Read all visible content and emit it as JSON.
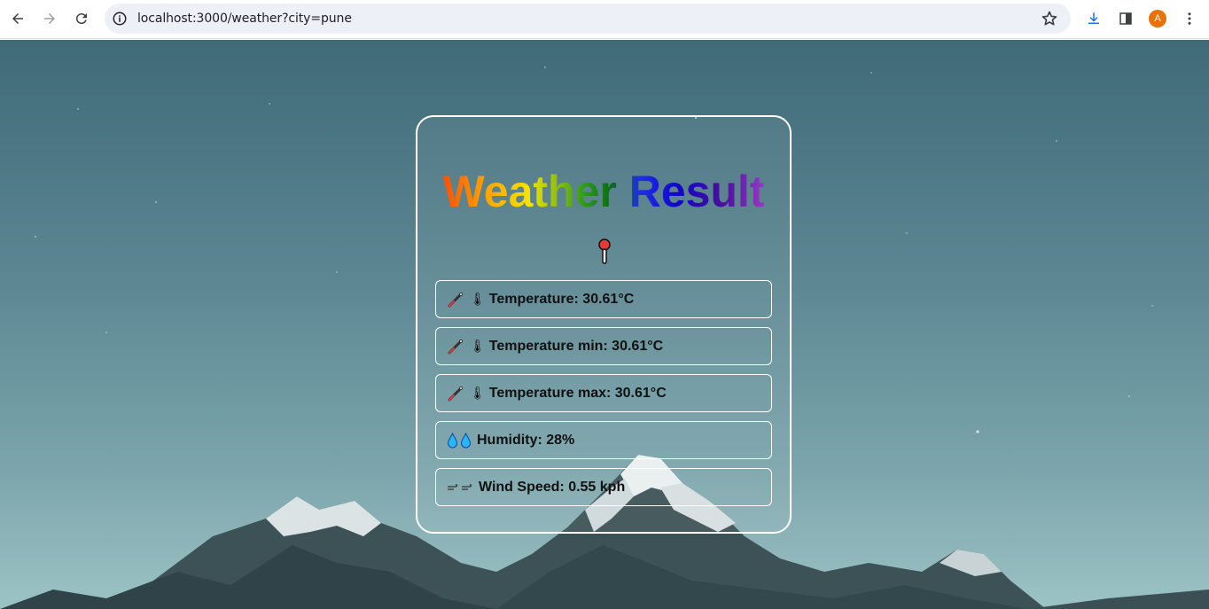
{
  "browser": {
    "url": "localhost:3000/weather?city=pune",
    "profile_initial": "A"
  },
  "card": {
    "title": "Weather Result",
    "rows": [
      {
        "icon": "thermometer-icon",
        "label": "Temperature: 30.61°C"
      },
      {
        "icon": "thermometer-icon",
        "label": "Temperature min: 30.61°C"
      },
      {
        "icon": "thermometer-icon",
        "label": "Temperature max: 30.61°C"
      },
      {
        "icon": "droplet-icon",
        "label": "Humidity: 28%"
      },
      {
        "icon": "wind-icon",
        "label": "Wind Speed: 0.55 kph"
      }
    ]
  },
  "colors": {
    "card_border": "#ffffff",
    "avatar": "#e8710a",
    "omnibox": "#eef0f7"
  }
}
